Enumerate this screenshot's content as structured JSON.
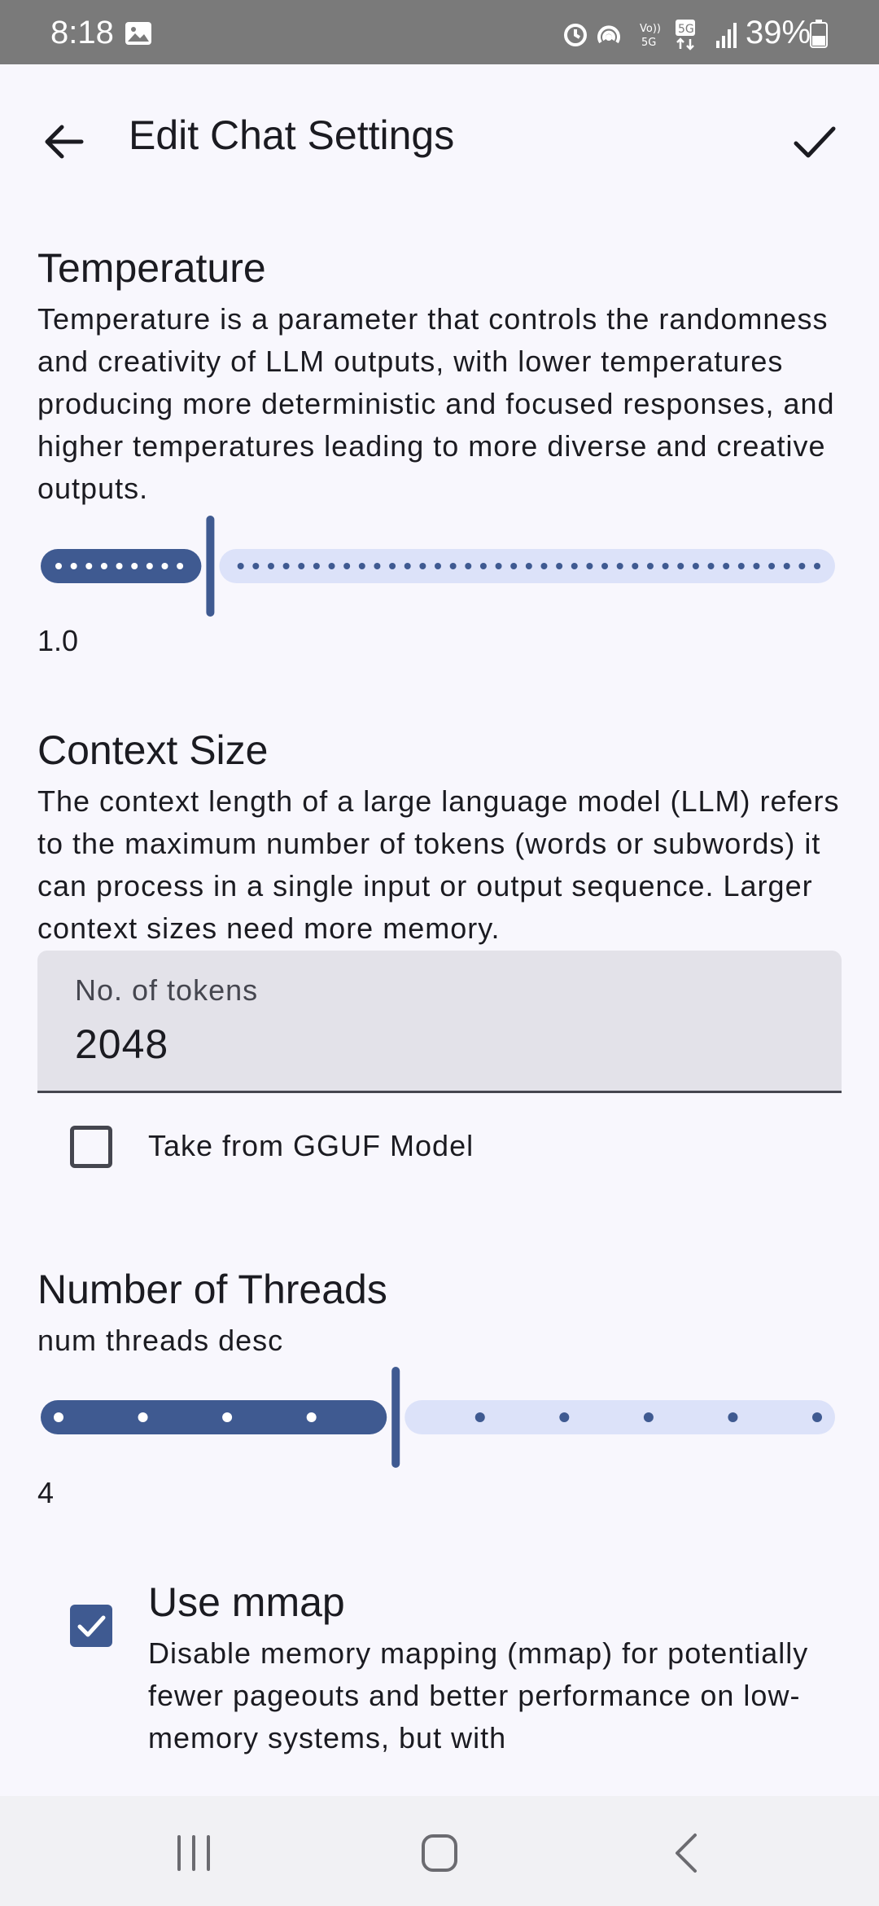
{
  "status_bar": {
    "time": "8:18",
    "battery": "39%",
    "icons": [
      "gallery-icon",
      "alarm-icon",
      "hotspot-icon",
      "volte-icon",
      "5g-icon",
      "signal-icon",
      "battery-icon"
    ]
  },
  "header": {
    "title": "Edit Chat Settings",
    "back_icon": "arrow-left-icon",
    "confirm_icon": "check-icon"
  },
  "temperature": {
    "title": "Temperature",
    "description": "Temperature is a parameter that controls the randomness and creativity of LLM outputs, with lower temperatures producing more deterministic and focused responses, and higher temperatures leading to more diverse and creative outputs.",
    "value_label": "1.0",
    "value": 1.0,
    "min": 0,
    "max": 5,
    "steps": 50
  },
  "context_size": {
    "title": "Context Size",
    "description": "The context length of a large language model (LLM) refers to the maximum number of tokens (words or subwords) it can process in a single input or output sequence. Larger context sizes need more memory.",
    "field_label": "No. of tokens",
    "field_value": "2048",
    "checkbox_label": "Take from GGUF Model",
    "checkbox_checked": false
  },
  "threads": {
    "title": "Number of Threads",
    "description": "num threads desc",
    "value_label": "4",
    "value": 4,
    "min": 0,
    "max": 9,
    "steps": 9
  },
  "mmap": {
    "title": "Use mmap",
    "description": "Disable memory mapping (mmap) for potentially fewer pageouts and better performance on low-memory systems, but with",
    "checked": true
  },
  "colors": {
    "accent": "#3f5a91",
    "track_inactive": "#dce2f9",
    "background": "#f8f7fd"
  }
}
